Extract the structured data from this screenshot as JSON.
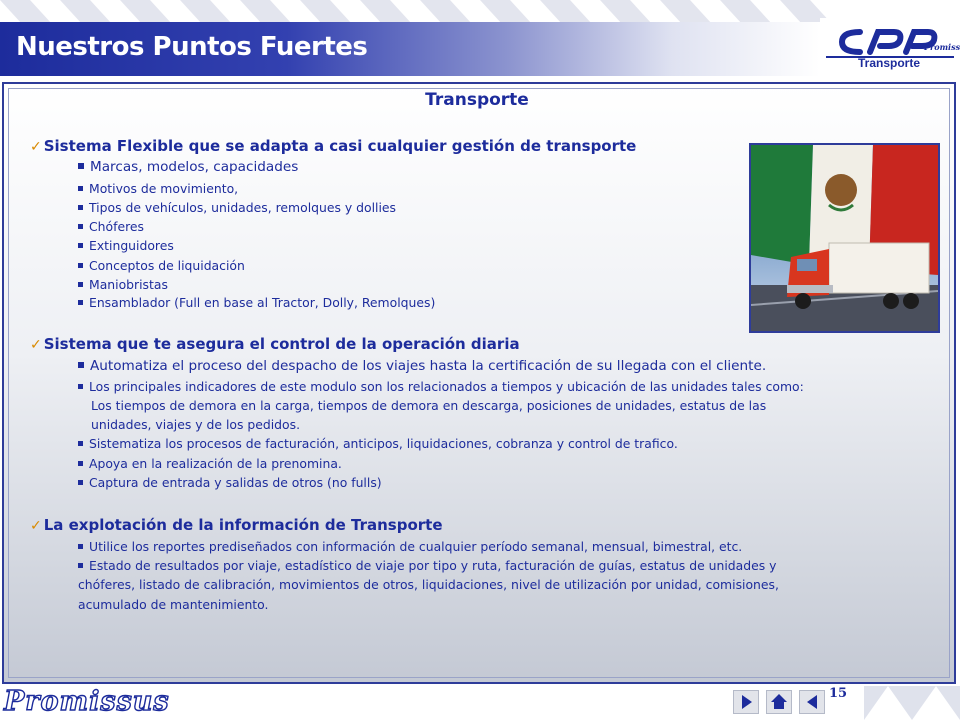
{
  "header": {
    "title": "Nuestros Puntos Fuertes",
    "logo_text": "Transporte"
  },
  "section_title": "Transporte",
  "sections": [
    {
      "heading": "Sistema Flexible que se adapta a casi cualquier gestión de transporte",
      "items": [
        "Marcas, modelos, capacidades",
        "Motivos de movimiento,",
        "Tipos de vehículos, unidades, remolques y dollies",
        "Chóferes",
        "Extinguidores",
        "Conceptos de liquidación",
        "Maniobristas",
        "Ensamblador (Full en base al Tractor, Dolly, Remolques)"
      ]
    },
    {
      "heading": "Sistema que te asegura el control de la operación diaria",
      "items": [
        "Automatiza el proceso del despacho de los viajes hasta la certificación de su llegada con el cliente.",
        "Los principales indicadores de este modulo son los relacionados a tiempos y ubicación de las unidades tales como:",
        "Los tiempos de demora en la carga, tiempos de demora en descarga, posiciones de unidades, estatus de las",
        "unidades, viajes y de los pedidos.",
        "Sistematiza los procesos de facturación, anticipos, liquidaciones, cobranza y control de trafico.",
        "Apoya en la realización de la prenomina.",
        "Captura de entrada y salidas de otros (no fulls)"
      ]
    },
    {
      "heading": "La explotación de la información de Transporte",
      "items": [
        "Utilice los reportes prediseñados con información de cualquier período semanal, mensual, bimestral, etc.",
        "Estado de resultados por viaje, estadístico de viaje por tipo y ruta, facturación de guías, estatus de unidades y",
        "chóferes, listado de calibración, movimientos de otros, liquidaciones, nivel de utilización por unidad, comisiones,",
        "acumulado de mantenimiento."
      ]
    }
  ],
  "footer": {
    "brand": "Promissus",
    "page_number": "15"
  },
  "colors": {
    "brand_blue": "#1d2c9c",
    "check_orange": "#d98a00"
  },
  "icons": [
    "check-icon",
    "square-bullet-icon",
    "next-arrow-icon",
    "home-icon",
    "prev-arrow-icon"
  ]
}
